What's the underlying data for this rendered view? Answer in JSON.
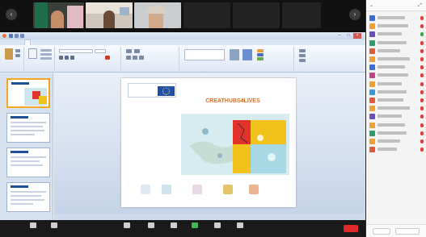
{
  "colors": {
    "accent_orange": "#f5a623",
    "ribbon_blue": "#dbe6f4",
    "mic_muted": "#e23b3b",
    "mic_on": "#3ba845",
    "end_red": "#e02a2a",
    "slide_title": "#e07020"
  },
  "video_strip": {
    "tiles": [
      {
        "label": ""
      },
      {
        "label": ""
      },
      {
        "label": ""
      },
      {
        "label": ""
      },
      {
        "label": ""
      },
      {
        "label": ""
      },
      {
        "label": ""
      }
    ],
    "nav_left_icon": "chevron-left-icon",
    "nav_right_icon": "chevron-right-icon"
  },
  "ppt": {
    "window_title": "",
    "ribbon_tabs": [
      "",
      "",
      "",
      "",
      "",
      "",
      "",
      ""
    ],
    "slide": {
      "title": "CREATHUBS4LIVES",
      "subtitle": "",
      "logo_text": "",
      "body_lines": [
        "",
        "",
        "",
        ""
      ],
      "map_icon": "map-illustration"
    },
    "status_text": ""
  },
  "participants_panel": {
    "title": "",
    "count": 17,
    "mic_states": [
      "off",
      "off",
      "on",
      "off",
      "off",
      "off",
      "off",
      "off",
      "off",
      "off",
      "off",
      "off",
      "off",
      "off",
      "off",
      "off",
      "off"
    ],
    "footer_buttons": [
      "",
      ""
    ]
  },
  "toolbar": {
    "buttons": [
      {
        "icon": "microphone-icon",
        "label": ""
      },
      {
        "icon": "video-camera-icon",
        "label": ""
      },
      {
        "icon": "security-icon",
        "label": ""
      },
      {
        "icon": "participants-icon",
        "label": ""
      },
      {
        "icon": "chat-icon",
        "label": ""
      },
      {
        "icon": "share-screen-icon",
        "label": ""
      },
      {
        "icon": "record-icon",
        "label": ""
      },
      {
        "icon": "reactions-icon",
        "label": ""
      }
    ],
    "end_label": ""
  }
}
